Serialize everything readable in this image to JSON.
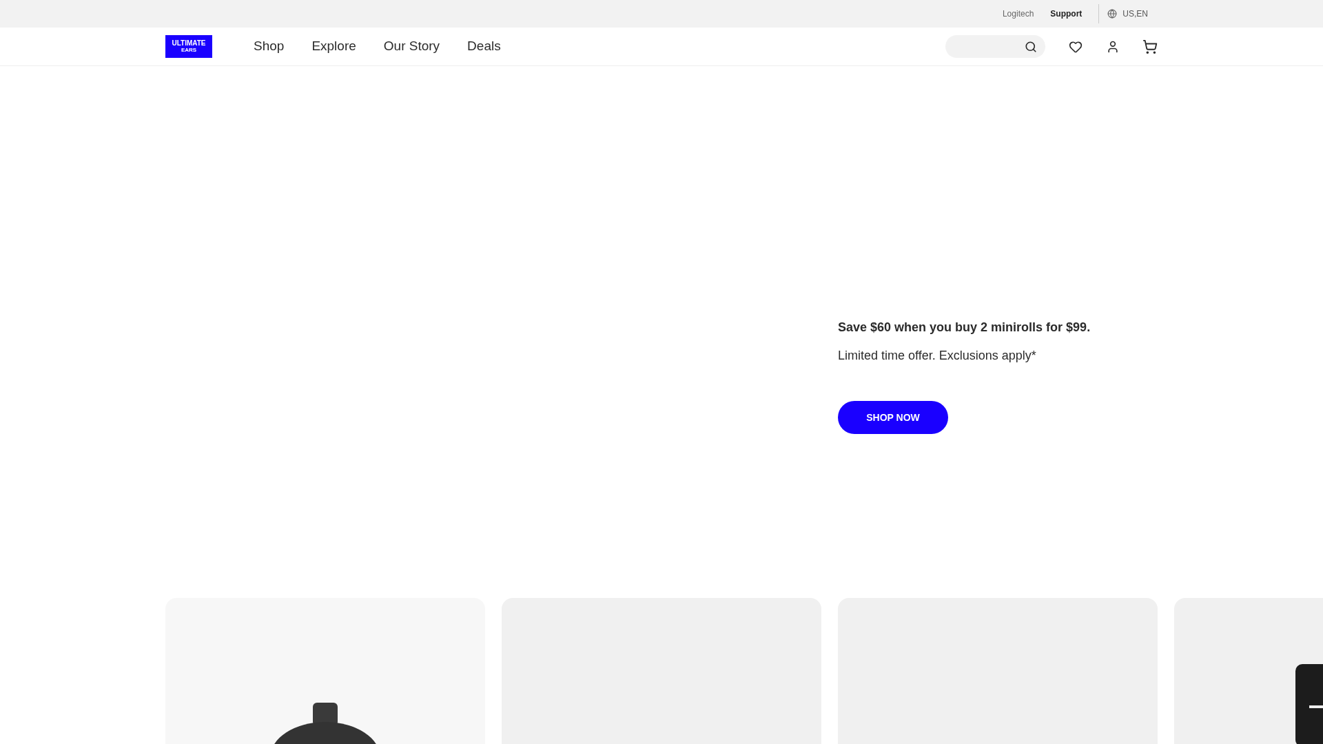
{
  "top_bar": {
    "links": [
      {
        "label": "Logitech",
        "selected": false
      },
      {
        "label": "Support",
        "selected": true
      }
    ],
    "locale": "US,EN"
  },
  "header": {
    "logo": [
      "ULTIMATE",
      "EARS"
    ],
    "nav": [
      "Shop",
      "Explore",
      "Our Story",
      "Deals"
    ]
  },
  "hero": {
    "headline": "Save $60 when you buy 2 minirolls for $99.",
    "subtitle": "Limited time offer. Exclusions apply*",
    "button": "SHOP NOW"
  },
  "cards": [
    {
      "kind": "speaker"
    },
    {
      "kind": "empty"
    },
    {
      "kind": "empty"
    },
    {
      "kind": "tall-speaker"
    }
  ]
}
